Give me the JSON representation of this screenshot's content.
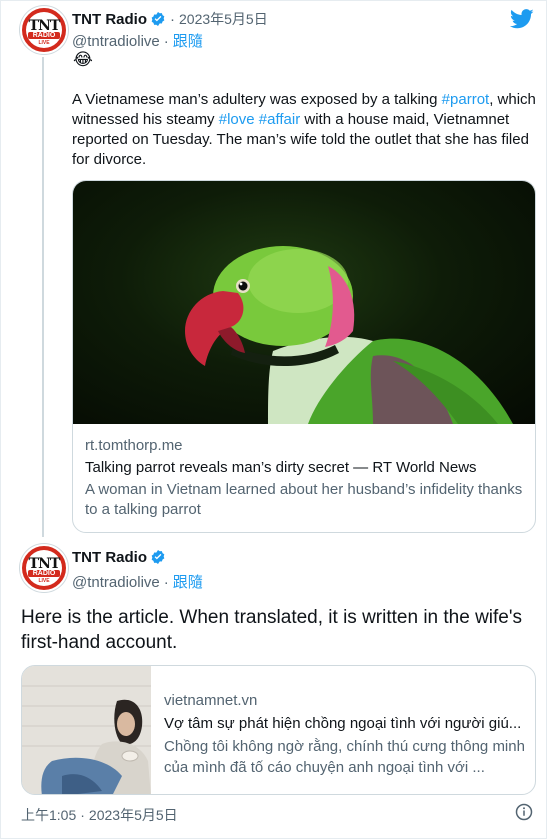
{
  "tweet": {
    "display_name": "TNT Radio",
    "handle": "@tntradiolive",
    "separator": "·",
    "date": "2023年5月5日",
    "follow_label": "跟隨",
    "emoji": "😂",
    "text_parts": [
      "A Vietnamese man’s adultery was exposed by a talking ",
      "#parrot",
      ", which witnessed his steamy ",
      "#love",
      " ",
      "#affair",
      " with a house maid, Vietnamnet reported on Tuesday. The man’s wife told the outlet that she has filed for divorce."
    ],
    "card": {
      "domain": "rt.tomthorp.me",
      "title": "Talking parrot reveals man’s dirty secret — RT World News",
      "description": "A woman in Vietnam learned about her husband’s infidelity thanks to a talking parrot"
    }
  },
  "reply": {
    "display_name": "TNT Radio",
    "handle": "@tntradiolive",
    "separator": "·",
    "follow_label": "跟隨",
    "text": "Here is the article. When translated, it is written in the wife's first-hand account.",
    "card": {
      "domain": "vietnamnet.vn",
      "title": "Vợ tâm sự phát hiện chồng ngoại tình với người giú...",
      "description": "Chồng tôi không ngờ rằng, chính thú cưng thông minh của mình đã tố cáo chuyện anh ngoại tình với ..."
    },
    "footer_time": "上午1:05",
    "footer_date": "2023年5月5日"
  },
  "avatar": {
    "line1": "TNT",
    "line2": "RADIO",
    "line3": "LIVE"
  },
  "colors": {
    "link": "#1d9bf0",
    "text": "#0f1419",
    "muted": "#536471",
    "border": "#cfd9de",
    "avatar_red": "#d32a1d",
    "parrot_green": "#6cc534"
  },
  "icons": {
    "verified": "verified-badge-icon",
    "twitter": "twitter-bird-icon",
    "info": "info-icon"
  }
}
